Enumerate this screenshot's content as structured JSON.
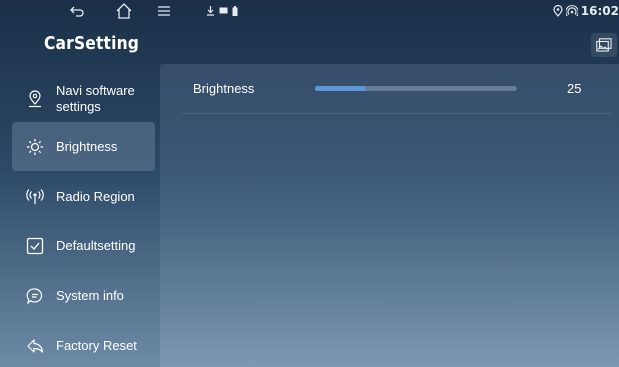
{
  "status_bar": {
    "clock": "16:02",
    "icons": [
      "back-icon",
      "home-icon",
      "menu-icon",
      "download-icon",
      "message-icon",
      "battery-icon",
      "location-icon",
      "hotspot-icon"
    ]
  },
  "app": {
    "title": "CarSetting"
  },
  "sidebar": {
    "items": [
      {
        "label": "Navi software settings",
        "icon": "location-pin-icon",
        "active": false
      },
      {
        "label": "Brightness",
        "icon": "sun-icon",
        "active": true
      },
      {
        "label": "Radio Region",
        "icon": "radio-icon",
        "active": false
      },
      {
        "label": "Defaultsetting",
        "icon": "checkbox-icon",
        "active": false
      },
      {
        "label": "System info",
        "icon": "chat-icon",
        "active": false
      },
      {
        "label": "Factory Reset",
        "icon": "reply-icon",
        "active": false
      }
    ]
  },
  "main": {
    "brightness": {
      "label": "Brightness",
      "value": "25",
      "level": 0.25,
      "accent": "#5c95d8"
    }
  },
  "colors": {
    "background_top": "#1b3048",
    "background_bottom": "#6d8ba6",
    "accent": "#5c95d8"
  }
}
